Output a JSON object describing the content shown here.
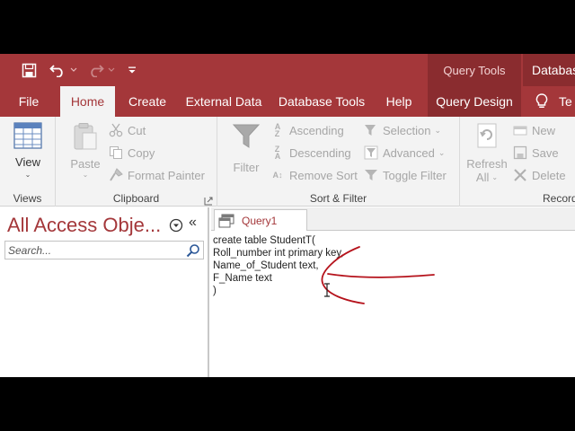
{
  "titlebar": {
    "context_tab": "Query Tools",
    "app_title": "Databas",
    "icons": [
      "save-icon",
      "undo-icon",
      "redo-icon",
      "customize-qat-icon"
    ]
  },
  "tabs": [
    {
      "label": "File",
      "active": false
    },
    {
      "label": "Home",
      "active": true
    },
    {
      "label": "Create",
      "active": false
    },
    {
      "label": "External Data",
      "active": false
    },
    {
      "label": "Database Tools",
      "active": false
    },
    {
      "label": "Help",
      "active": false
    },
    {
      "label": "Query Design",
      "active": false
    },
    {
      "label": "Te",
      "active": false
    }
  ],
  "ribbon": {
    "views": {
      "label": "Views",
      "view_btn": "View"
    },
    "clipboard": {
      "label": "Clipboard",
      "paste": "Paste",
      "cut": "Cut",
      "copy": "Copy",
      "format_painter": "Format Painter"
    },
    "sort_filter": {
      "label": "Sort & Filter",
      "filter": "Filter",
      "ascending": "Ascending",
      "descending": "Descending",
      "remove_sort": "Remove Sort",
      "selection": "Selection",
      "advanced": "Advanced",
      "toggle_filter": "Toggle Filter"
    },
    "records": {
      "label": "Record",
      "refresh": "Refresh",
      "refresh_all": "All",
      "new": "New",
      "save": "Save",
      "delete": "Delete"
    }
  },
  "nav": {
    "title": "All Access Obje...",
    "search_placeholder": "Search..."
  },
  "document": {
    "tab_label": "Query1",
    "sql_lines": [
      "create table StudentT(",
      "Roll_number int primary key,",
      "Name_of_Student text,",
      "F_Name text",
      ")"
    ]
  },
  "colors": {
    "brand": "#a4373a",
    "ribbon_bg": "#f3f3f3",
    "annotation": "#b5121b"
  }
}
